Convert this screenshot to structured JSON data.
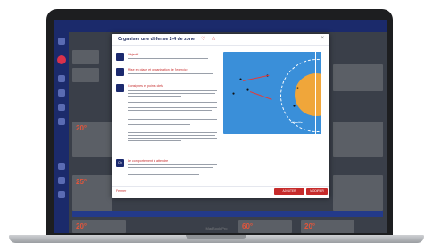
{
  "device": {
    "brand": "MacBook Pro"
  },
  "modal": {
    "title": "Organiser une défense 2-4 de zone",
    "sections": [
      {
        "num": "",
        "heading": "Objectif"
      },
      {
        "num": "",
        "heading": "Mise en place et organisation de l'exercice"
      },
      {
        "num": "",
        "heading": "Consignes et points clefs"
      },
      {
        "num": "Ob",
        "heading": "Le comportement à attendre"
      }
    ],
    "court_brand": "dtactic",
    "cancel_label": "Fermer",
    "action1_label": "AJOUTER",
    "action2_label": "MODIFIER"
  },
  "background": {
    "temps": [
      "20°",
      "25°",
      "20°",
      "60°",
      "20°"
    ]
  },
  "colors": {
    "accent": "#c62b2b",
    "navy": "#1c2a6e",
    "court": "#3a8fd9",
    "zone": "#f0a63a"
  }
}
